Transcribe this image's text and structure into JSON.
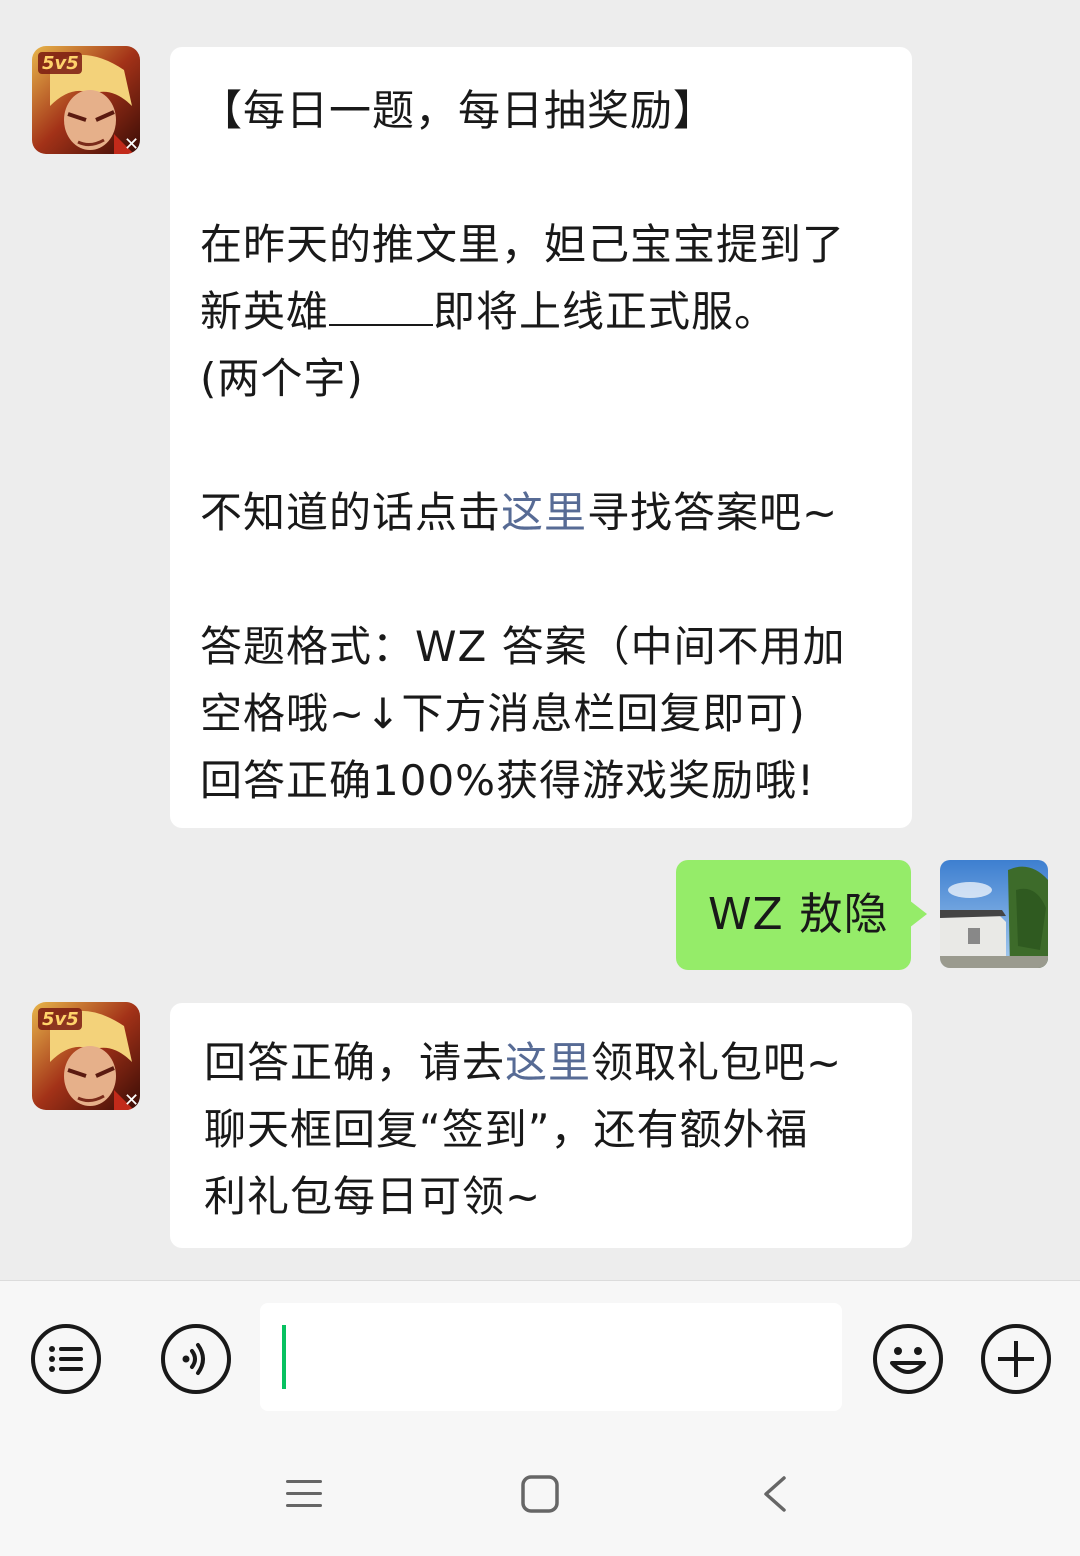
{
  "messages": [
    {
      "sender": "official-account",
      "avatar_badge": "5v5",
      "lines": [
        {
          "parts": [
            {
              "text": "【每日一题，每日抽奖励】"
            }
          ]
        },
        {
          "parts": [
            {
              "text": ""
            }
          ]
        },
        {
          "parts": [
            {
              "text": "在昨天的推文里，妲己宝宝提到了"
            }
          ]
        },
        {
          "parts": [
            {
              "text": "新英雄"
            },
            {
              "blank": true
            },
            {
              "text": "即将上线正式服。"
            }
          ]
        },
        {
          "parts": [
            {
              "text": "(两个字)"
            }
          ]
        },
        {
          "parts": [
            {
              "text": ""
            }
          ]
        },
        {
          "parts": [
            {
              "text": "不知道的话点击"
            },
            {
              "text": "这里",
              "link": true
            },
            {
              "text": "寻找答案吧~"
            }
          ]
        },
        {
          "parts": [
            {
              "text": ""
            }
          ]
        },
        {
          "parts": [
            {
              "text": "答题格式：WZ 答案（中间不用加"
            }
          ]
        },
        {
          "parts": [
            {
              "text": "空格哦~↓下方消息栏回复即可)"
            }
          ]
        },
        {
          "parts": [
            {
              "text": "回答正确100%获得游戏奖励哦!"
            }
          ]
        }
      ]
    },
    {
      "sender": "me",
      "text": "WZ 敖隐"
    },
    {
      "sender": "official-account",
      "avatar_badge": "5v5",
      "lines": [
        {
          "parts": [
            {
              "text": "回答正确，请去"
            },
            {
              "text": "这里",
              "link": true
            },
            {
              "text": "领取礼包吧~"
            }
          ]
        },
        {
          "parts": [
            {
              "text": "聊天框回复“签到”，还有额外福"
            }
          ]
        },
        {
          "parts": [
            {
              "text": "利礼包每日可领~"
            }
          ]
        }
      ]
    }
  ],
  "input_bar": {
    "left_icons": [
      "menu-list-icon",
      "voice-icon"
    ],
    "right_icons": [
      "emoji-icon",
      "plus-icon"
    ],
    "input_value": ""
  },
  "system_nav": [
    "menu-icon",
    "home-icon",
    "back-icon"
  ],
  "colors": {
    "background": "#ededed",
    "bubble_other": "#ffffff",
    "bubble_me": "#95ec69",
    "link": "#576b95",
    "caret": "#07c160"
  }
}
